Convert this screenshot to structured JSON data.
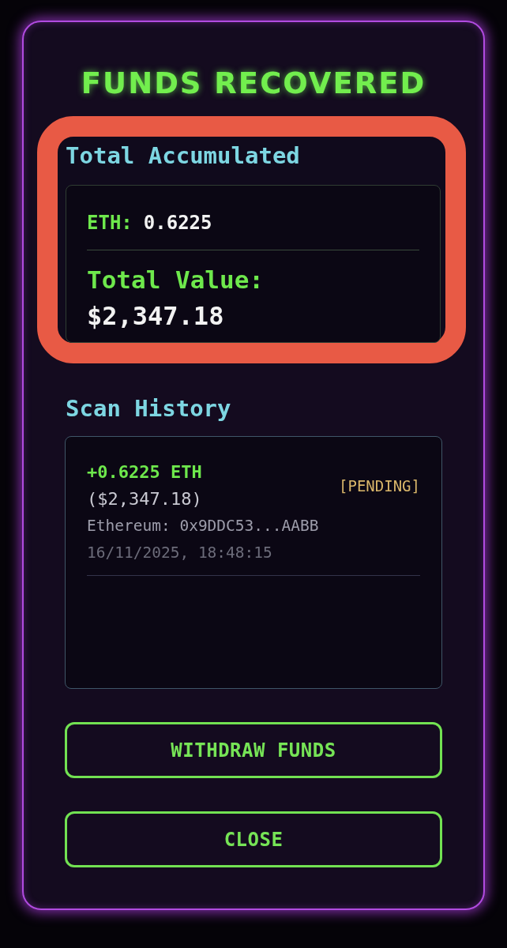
{
  "dialog": {
    "title": "FUNDS RECOVERED"
  },
  "total_accumulated": {
    "highlighted": true,
    "heading": "Total Accumulated",
    "eth_label": "ETH:",
    "eth_value": "0.6225",
    "total_label": "Total Value:",
    "total_value": "$2,347.18"
  },
  "scan_history": {
    "heading": "Scan History",
    "entries": [
      {
        "amount": "+0.6225 ETH",
        "value": "($2,347.18)",
        "status": {
          "text": "[PENDING]",
          "kind": "pending"
        },
        "address": "Ethereum: 0x9DDC53...AABB",
        "timestamp": "16/11/2025, 18:48:15"
      }
    ]
  },
  "buttons": [
    {
      "label": "WITHDRAW FUNDS"
    },
    {
      "label": "CLOSE"
    }
  ]
}
